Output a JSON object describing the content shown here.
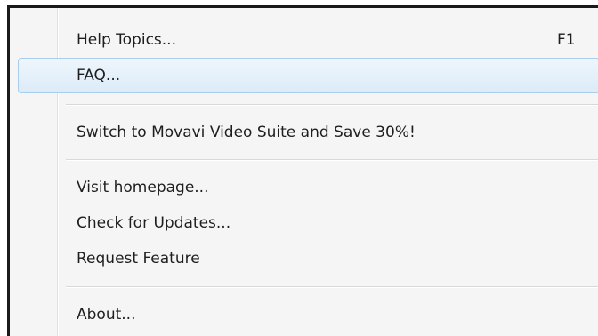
{
  "menu": {
    "items": [
      {
        "label": "Help Topics...",
        "shortcut": "F1"
      },
      {
        "label": "FAQ..."
      },
      {
        "label": "Switch to Movavi Video Suite and Save 30%!"
      },
      {
        "label": "Visit homepage..."
      },
      {
        "label": "Check for Updates..."
      },
      {
        "label": "Request Feature"
      },
      {
        "label": "About..."
      }
    ],
    "highlighted_item": "FAQ..."
  }
}
